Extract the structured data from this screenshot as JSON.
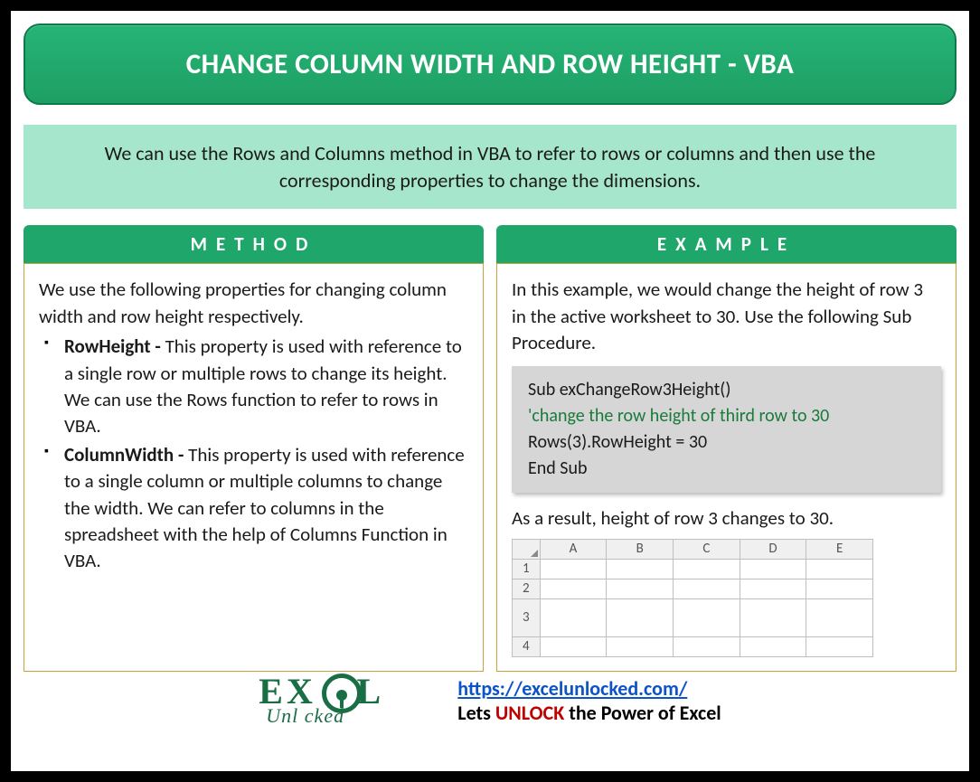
{
  "title": "CHANGE COLUMN WIDTH AND ROW HEIGHT - VBA",
  "intro": "We can use the Rows and Columns method in VBA to refer to rows or columns and then use the corresponding properties to change the dimensions.",
  "method": {
    "tab": "METHOD",
    "lead": "We use the following properties for changing column width and row height respectively.",
    "items": [
      {
        "name": "RowHeight - ",
        "desc": "This property is used with reference to a single row or multiple rows to change its height. We can use the Rows function to refer to rows in VBA."
      },
      {
        "name": "ColumnWidth - ",
        "desc": "This property is used with reference to a single column or multiple columns to change the width. We can refer to columns in the spreadsheet with the help of Columns Function in VBA."
      }
    ]
  },
  "example": {
    "tab": "EXAMPLE",
    "lead": "In this example, we would change the height of row 3 in the active worksheet to 30. Use the following Sub Procedure.",
    "code": {
      "l1": "Sub exChangeRow3Height()",
      "l2": "'change the row height of third row to 30",
      "l3": "Rows(3).RowHeight = 30",
      "l4": "End Sub"
    },
    "result": "As a result, height of row 3 changes to 30.",
    "sheet": {
      "cols": [
        "A",
        "B",
        "C",
        "D",
        "E"
      ],
      "rows": [
        "1",
        "2",
        "3",
        "4"
      ],
      "tall_row_index": 2
    }
  },
  "footer": {
    "logo_main": "EX  EL",
    "logo_sub": "Unl  cked",
    "url": "https://excelunlocked.com/",
    "tag_pre": "Lets ",
    "tag_unlock": "UNLOCK",
    "tag_post": " the Power of Excel"
  }
}
